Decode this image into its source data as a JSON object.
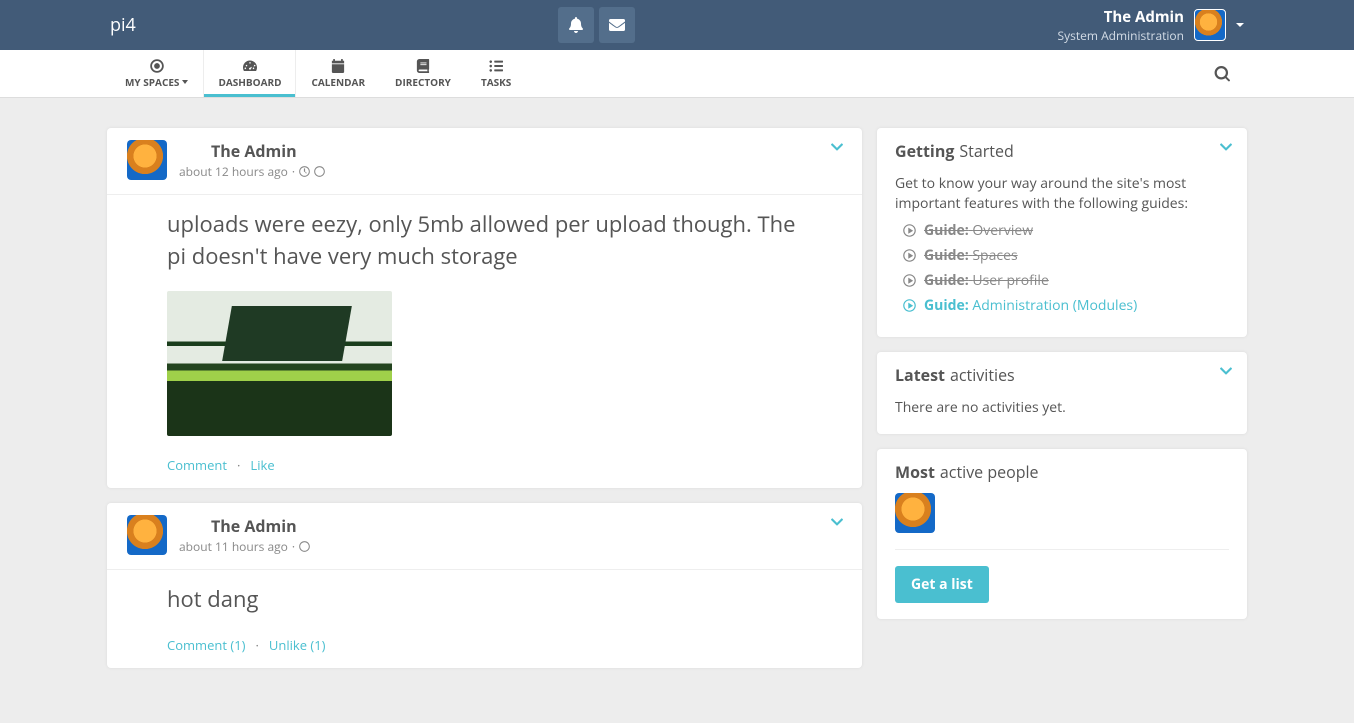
{
  "brand": "pi4",
  "user": {
    "displayName": "The Admin",
    "subtitle": "System Administration"
  },
  "nav": {
    "mySpaces": "MY SPACES",
    "dashboard": "DASHBOARD",
    "calendar": "CALENDAR",
    "directory": "DIRECTORY",
    "tasks": "TASKS"
  },
  "posts": [
    {
      "author": "The Admin",
      "time": "about 12 hours ago",
      "body": "uploads were eezy, only 5mb allowed per upload though. The pi doesn't have very much storage",
      "hasImage": true,
      "actions": {
        "comment": "Comment",
        "like": "Like"
      }
    },
    {
      "author": "The Admin",
      "time": "about 11 hours ago",
      "body": "hot dang",
      "hasImage": false,
      "actions": {
        "comment": "Comment (1)",
        "like": "Unlike (1)"
      }
    }
  ],
  "gettingStarted": {
    "titleStrong": "Getting",
    "titleRest": "Started",
    "intro": "Get to know your way around the site's most important features with the following guides:",
    "guides": [
      {
        "labelStrong": "Guide:",
        "labelRest": "Overview",
        "done": true
      },
      {
        "labelStrong": "Guide:",
        "labelRest": "Spaces",
        "done": true
      },
      {
        "labelStrong": "Guide:",
        "labelRest": "User profile",
        "done": true
      },
      {
        "labelStrong": "Guide:",
        "labelRest": "Administration (Modules)",
        "done": false
      }
    ]
  },
  "latestActivities": {
    "titleStrong": "Latest",
    "titleRest": "activities",
    "empty": "There are no activities yet."
  },
  "mostActive": {
    "titleStrong": "Most",
    "titleRest": "active people",
    "button": "Get a list"
  }
}
